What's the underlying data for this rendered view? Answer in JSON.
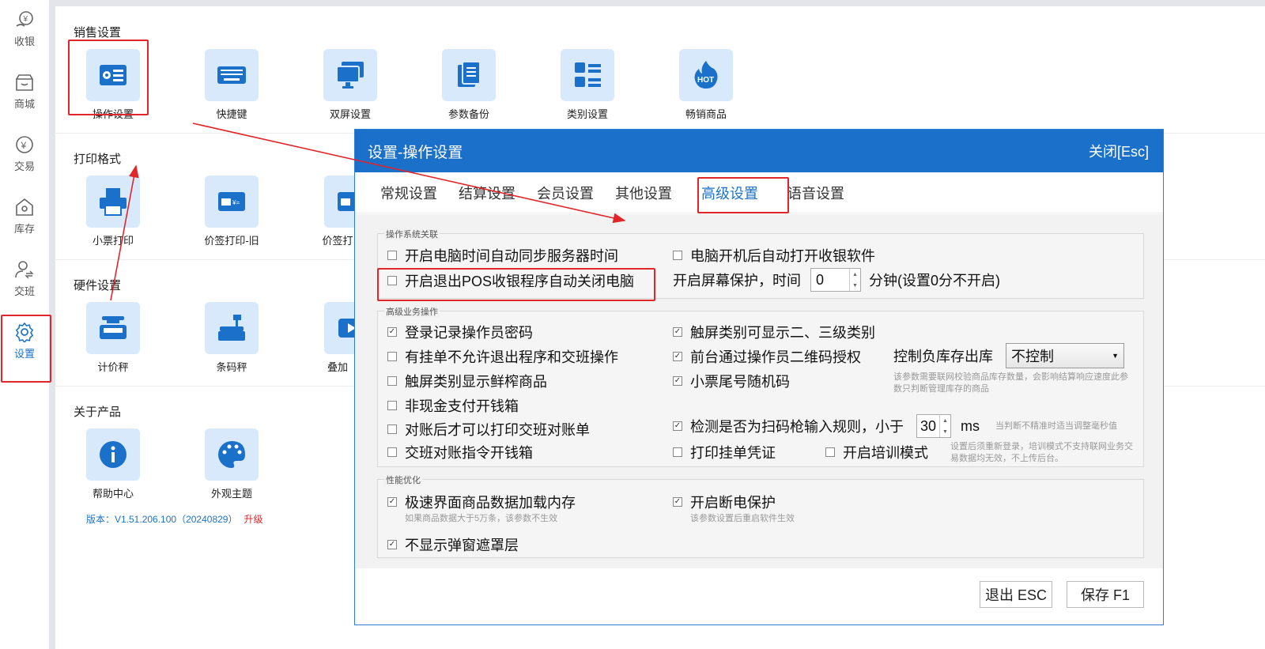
{
  "sidebar": {
    "items": [
      {
        "label": "收银",
        "icon": "yen-coin-icon"
      },
      {
        "label": "商城",
        "icon": "store-icon"
      },
      {
        "label": "交易",
        "icon": "yen-circle-icon"
      },
      {
        "label": "库存",
        "icon": "warehouse-icon"
      },
      {
        "label": "交班",
        "icon": "user-switch-icon"
      },
      {
        "label": "设置",
        "icon": "gear-icon"
      }
    ],
    "active": "设置"
  },
  "sections": {
    "sales": {
      "title": "销售设置",
      "tiles": [
        {
          "label": "操作设置",
          "icon": "settings-list-icon"
        },
        {
          "label": "快捷键",
          "icon": "keyboard-icon"
        },
        {
          "label": "双屏设置",
          "icon": "dual-monitor-icon"
        },
        {
          "label": "参数备份",
          "icon": "document-copy-icon"
        },
        {
          "label": "类别设置",
          "icon": "category-list-icon"
        },
        {
          "label": "畅销商品",
          "icon": "hot-flame-icon"
        }
      ]
    },
    "print": {
      "title": "打印格式",
      "tiles": [
        {
          "label": "小票打印",
          "icon": "printer-icon"
        },
        {
          "label": "价签打印-旧",
          "icon": "price-tag-icon"
        },
        {
          "label": "价签打",
          "icon": "price-tag-icon"
        }
      ]
    },
    "hardware": {
      "title": "硬件设置",
      "tiles": [
        {
          "label": "计价秤",
          "icon": "pricing-scale-icon"
        },
        {
          "label": "条码秤",
          "icon": "barcode-scale-icon"
        },
        {
          "label": "叠加",
          "icon": "video-overlay-icon"
        }
      ]
    },
    "about": {
      "title": "关于产品",
      "tiles": [
        {
          "label": "帮助中心",
          "icon": "info-icon"
        },
        {
          "label": "外观主题",
          "icon": "palette-icon"
        }
      ]
    }
  },
  "version": {
    "text": "版本：V1.51.206.100（20240829）",
    "upgrade": "升级"
  },
  "dialog": {
    "title": "设置-操作设置",
    "close": "关闭[Esc]",
    "tabs": [
      "常规设置",
      "结算设置",
      "会员设置",
      "其他设置",
      "高级设置",
      "语音设置"
    ],
    "active_tab": "高级设置",
    "os": {
      "title": "操作系统关联",
      "sync_time": {
        "label": "开启电脑时间自动同步服务器时间",
        "checked": false
      },
      "auto_start": {
        "label": "电脑开机后自动打开收银软件",
        "checked": false
      },
      "auto_shutdown": {
        "label": "开启退出POS收银程序自动关闭电脑",
        "checked": false
      },
      "screensaver_label": "开启屏幕保护，时间",
      "screensaver_value": "0",
      "screensaver_unit": "分钟(设置0分不开启)"
    },
    "adv": {
      "title": "高级业务操作",
      "login_pwd": {
        "label": "登录记录操作员密码",
        "checked": true
      },
      "pending_exit": {
        "label": "有挂单不允许退出程序和交班操作",
        "checked": false
      },
      "fresh_goods": {
        "label": "触屏类别显示鲜榨商品",
        "checked": false
      },
      "non_cash_drawer": {
        "label": "非现金支付开钱箱",
        "checked": false
      },
      "print_after_check": {
        "label": "对账后才可以打印交班对账单",
        "checked": false
      },
      "shift_drawer": {
        "label": "交班对账指令开钱箱",
        "checked": false
      },
      "sub_category": {
        "label": "触屏类别可显示二、三级类别",
        "checked": true
      },
      "qr_auth": {
        "label": "前台通过操作员二维码授权",
        "checked": true
      },
      "random_tail": {
        "label": "小票尾号随机码",
        "checked": true
      },
      "scanner_detect": {
        "label": "检测是否为扫码枪输入规则，小于",
        "checked": true
      },
      "scanner_value": "30",
      "scanner_unit": "ms",
      "scanner_hint": "当判断不精准时适当调整毫秒值",
      "print_pending": {
        "label": "打印挂单凭证",
        "checked": false
      },
      "training": {
        "label": "开启培训模式",
        "checked": false
      },
      "training_hint": "设置后须重新登录，培训模式不支持联网业务交易数据均无效，不上传后台。",
      "neg_stock_label": "控制负库存出库",
      "neg_stock_value": "不控制",
      "neg_stock_hint": "该参数需要联网校验商品库存数量，会影响结算响应速度此参数只判断管理库存的商品"
    },
    "perf": {
      "title": "性能优化",
      "fast_load": {
        "label": "极速界面商品数据加载内存",
        "checked": true
      },
      "fast_load_hint": "如果商品数据大于5万条，该参数不生效",
      "power_protect": {
        "label": "开启断电保护",
        "checked": true
      },
      "power_hint": "该参数设置后重启软件生效",
      "no_mask": {
        "label": "不显示弹窗遮罩层",
        "checked": true
      }
    },
    "buttons": {
      "exit": "退出 ESC",
      "save": "保存 F1"
    }
  }
}
